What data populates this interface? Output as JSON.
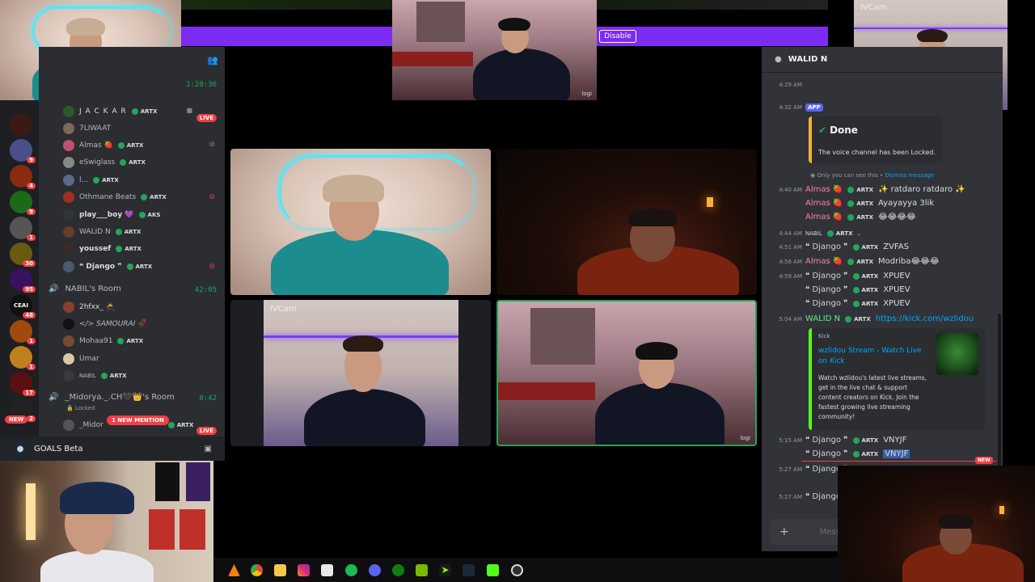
{
  "top_banner": {
    "disable_label": "Disable"
  },
  "cams": {
    "ivcam_top": "iVCam",
    "ivcam_grid": "iVCam",
    "logi_top": "logi",
    "logi_grid": "logi"
  },
  "sidebar": {
    "top_timer": "1:28:36",
    "voice_users": [
      {
        "name": "J A C K A R",
        "tag": "ARTX",
        "live": "LIVE"
      },
      {
        "name": "7LIWAAT"
      },
      {
        "name": "Almas 🍓",
        "tag": "ARTX"
      },
      {
        "name": "eSwiglass",
        "tag": "ARTX"
      },
      {
        "name": "l...",
        "tag": "ARTX"
      },
      {
        "name": "Othmane Beats",
        "tag": "ARTX"
      },
      {
        "name": "play___boy 💜",
        "tag": "AKS"
      },
      {
        "name": "WALID N",
        "tag": "ARTX"
      },
      {
        "name": "youssef",
        "tag": "ARTX"
      },
      {
        "name": "❝ Django ❞",
        "tag": "ARTX"
      }
    ],
    "room1": {
      "name": "NABIL's Room",
      "timer": "42:05"
    },
    "room1_users": [
      {
        "name": "2hfxx_ 🥷"
      },
      {
        "name": "</> SAMOURAI 🥀"
      },
      {
        "name": "Mohaa91",
        "tag": "ARTX"
      },
      {
        "name": "Umar"
      },
      {
        "name": "NABIL",
        "tag": "ARTX"
      }
    ],
    "room2": {
      "name": "_Midorya._.CH🖤👑's Room",
      "timer": "0:42",
      "locked": "Locked"
    },
    "room2_partial": {
      "name": "_Midor",
      "tag": "ARTX",
      "live": "LIVE"
    },
    "new_mention": "1 NEW MENTION",
    "new_badge": "NEW",
    "activity": "GOALS Beta",
    "guild_badges": [
      "9",
      "4",
      "9",
      "1",
      "30",
      "95",
      "48",
      "1",
      "1",
      "17",
      "2"
    ],
    "guild_labels": [
      "CEAI"
    ]
  },
  "chat": {
    "channel_title": "WALID N",
    "done_title": "Done",
    "done_text": "The voice channel has been Locked.",
    "ephemeral": "Only you can see this • ",
    "dismiss": "Dismiss message",
    "app_badge": "APP",
    "messages": [
      {
        "ts": "4:29 AM",
        "author": "",
        "text": ""
      },
      {
        "ts": "4:32 AM",
        "author": "",
        "text": ""
      },
      {
        "ts": "4:40 AM",
        "author": "Almas 🍓",
        "tag": "ARTX",
        "text": "✨ ratdaro ratdaro ✨"
      },
      {
        "ts": "",
        "author": "Almas 🍓",
        "tag": "ARTX",
        "text": "Ayayayya 3lik"
      },
      {
        "ts": "",
        "author": "Almas 🍓",
        "tag": "ARTX",
        "text": "😂😂😂😂"
      },
      {
        "ts": "4:44 AM",
        "author": "NABIL",
        "tag": "ARTX",
        "text": "."
      },
      {
        "ts": "4:51 AM",
        "author": "❝ Django ❞",
        "tag": "ARTX",
        "text": "ZVFAS"
      },
      {
        "ts": "4:56 AM",
        "author": "Almas 🍓",
        "tag": "ARTX",
        "text": "Modriba😂😂😂"
      },
      {
        "ts": "4:59 AM",
        "author": "❝ Django ❞",
        "tag": "ARTX",
        "text": "XPUEV"
      },
      {
        "ts": "",
        "author": "❝ Django ❞",
        "tag": "ARTX",
        "text": "XPUEV"
      },
      {
        "ts": "",
        "author": "❝ Django ❞",
        "tag": "ARTX",
        "text": "XPUEV"
      },
      {
        "ts": "5:04 AM",
        "author": "WALID N",
        "tag": "ARTX",
        "link": "https://kick.com/wzlidou"
      }
    ],
    "embed": {
      "provider": "Kick",
      "title": "wzlidou Stream - Watch Live on Kick",
      "description": "Watch wzlidou's latest live streams, get in the live chat & support content creators on Kick. Join the fastest growing live streaming community!"
    },
    "later_messages": [
      {
        "ts": "5:15 AM",
        "author": "❝ Django ❞",
        "tag": "ARTX",
        "text": "VNYJF"
      },
      {
        "ts": "",
        "author": "❝ Django ❞",
        "tag": "ARTX",
        "text": "VNYJF"
      },
      {
        "ts": "5:27 AM",
        "author": "❝ Django ❞",
        "text": ""
      },
      {
        "ts": "5:27 AM",
        "author": "❝ Django ❞",
        "text": ""
      }
    ],
    "new_marker": "NEW",
    "input_placeholder": "Message"
  },
  "colors": {
    "accent_purple": "#7c2cf2",
    "discord_green": "#23a55a",
    "live_red": "#f23f43"
  }
}
